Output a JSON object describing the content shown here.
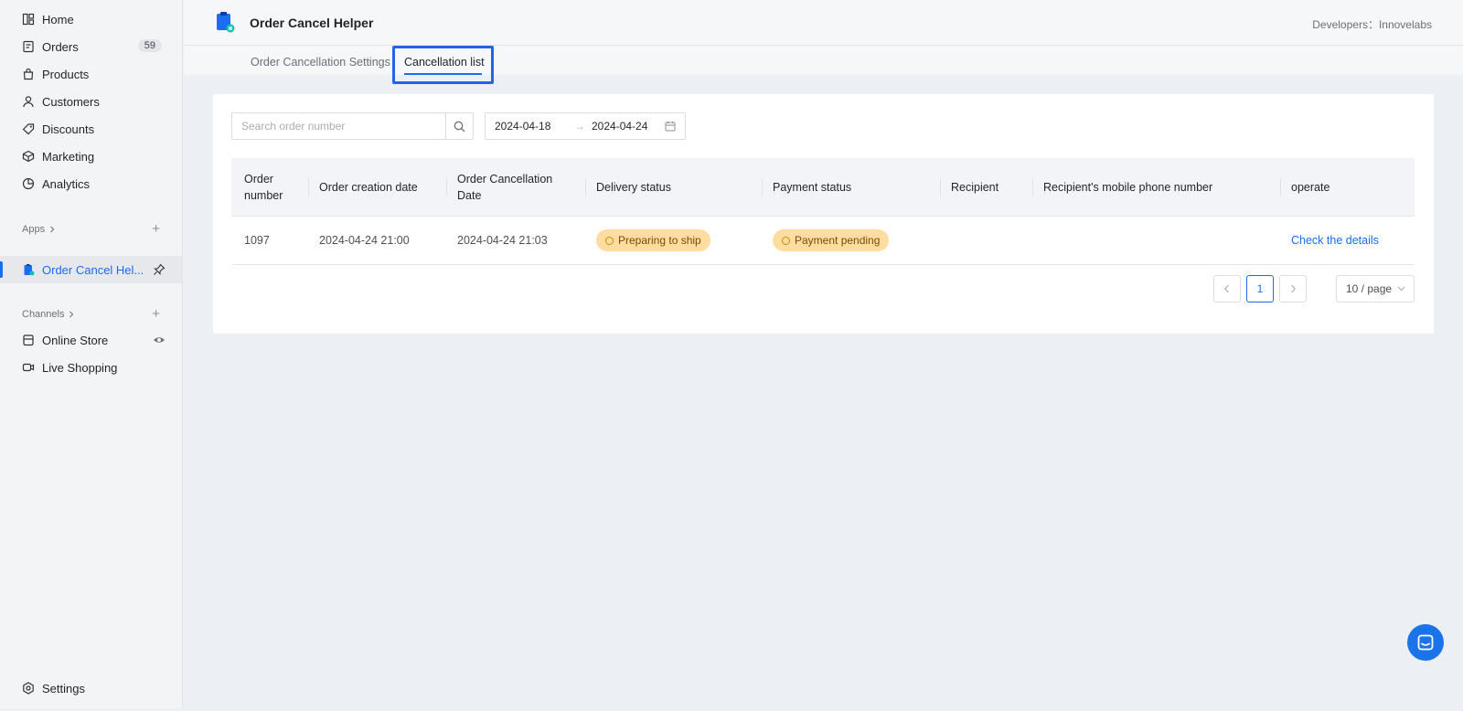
{
  "sidebar": {
    "items": [
      {
        "label": "Home",
        "icon": "home-icon"
      },
      {
        "label": "Orders",
        "icon": "orders-icon",
        "badge": "59"
      },
      {
        "label": "Products",
        "icon": "products-icon"
      },
      {
        "label": "Customers",
        "icon": "customers-icon"
      },
      {
        "label": "Discounts",
        "icon": "discounts-icon"
      },
      {
        "label": "Marketing",
        "icon": "marketing-icon"
      },
      {
        "label": "Analytics",
        "icon": "analytics-icon"
      }
    ],
    "apps_label": "Apps",
    "active_app": "Order Cancel Hel...",
    "channels_label": "Channels",
    "channels": [
      {
        "label": "Online Store",
        "icon": "store-icon"
      },
      {
        "label": "Live Shopping",
        "icon": "live-shopping-icon"
      }
    ],
    "settings_label": "Settings"
  },
  "header": {
    "app_title": "Order Cancel Helper",
    "developers": "Developers：Innovelabs"
  },
  "tabs": [
    {
      "label": "Order Cancellation Settings",
      "active": false
    },
    {
      "label": "Cancellation list",
      "active": true
    }
  ],
  "filters": {
    "search_placeholder": "Search order number",
    "date_start": "2024-04-18",
    "date_arrow": "→",
    "date_end": "2024-04-24"
  },
  "table": {
    "headers": [
      "Order number",
      "Order creation date",
      "Order Cancellation Date",
      "Delivery status",
      "Payment status",
      "Recipient",
      "Recipient's mobile phone number",
      "operate"
    ],
    "rows": [
      {
        "order_number": "1097",
        "created": "2024-04-24 21:00",
        "cancelled": "2024-04-24 21:03",
        "delivery_status": "Preparing to ship",
        "payment_status": "Payment pending",
        "recipient": "",
        "phone": "",
        "action": "Check the details"
      }
    ]
  },
  "pagination": {
    "prev": "<",
    "current": "1",
    "next": ">",
    "page_size": "10 / page"
  },
  "colors": {
    "accent": "#1a6cf0",
    "status_bg": "#ffdda1",
    "highlight": "#2563eb"
  }
}
